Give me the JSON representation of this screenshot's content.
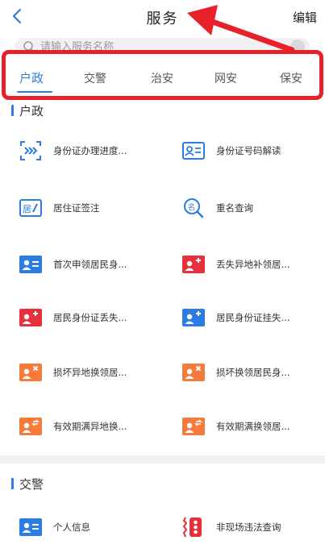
{
  "header": {
    "title": "服务",
    "edit_label": "编辑"
  },
  "search": {
    "placeholder": "请输入服务名称"
  },
  "tabs": [
    {
      "label": "户政",
      "active": true
    },
    {
      "label": "交警",
      "active": false
    },
    {
      "label": "治安",
      "active": false
    },
    {
      "label": "网安",
      "active": false
    },
    {
      "label": "保安",
      "active": false
    }
  ],
  "sections": [
    {
      "title": "户政",
      "items": [
        {
          "label": "身份证办理进度...",
          "icon": "scan-progress-icon",
          "color": "#2b7de3"
        },
        {
          "label": "身份证号码解读",
          "icon": "id-card-outline-icon",
          "color": "#2b7de3"
        },
        {
          "label": "居住证签注",
          "icon": "residence-permit-icon",
          "color": "#2b7de3"
        },
        {
          "label": "重名查询",
          "icon": "name-search-icon",
          "color": "#2b7de3"
        },
        {
          "label": "首次申领居民身...",
          "icon": "id-card-blue-icon",
          "color": "#2b7de3"
        },
        {
          "label": "丢失异地补领居...",
          "icon": "id-card-red-plus-icon",
          "color": "#e8303a"
        },
        {
          "label": "居民身份证丢失...",
          "icon": "id-card-red-plus-icon",
          "color": "#e8303a"
        },
        {
          "label": "居民身份证挂失...",
          "icon": "id-card-blue-plus-icon",
          "color": "#2b7de3"
        },
        {
          "label": "损坏异地换领居...",
          "icon": "id-card-orange-x-icon",
          "color": "#f47b3c"
        },
        {
          "label": "损坏换领居民身...",
          "icon": "id-card-orange-x-icon",
          "color": "#f47b3c"
        },
        {
          "label": "有效期满异地换...",
          "icon": "id-card-orange-swap-icon",
          "color": "#f47b3c"
        },
        {
          "label": "有效期满换领居...",
          "icon": "id-card-orange-swap-icon",
          "color": "#f47b3c"
        }
      ]
    },
    {
      "title": "交警",
      "items": [
        {
          "label": "个人信息",
          "icon": "id-card-blue-icon",
          "color": "#2b7de3"
        },
        {
          "label": "非现场违法查询",
          "icon": "violation-query-icon",
          "color": "#e8303a"
        }
      ]
    }
  ],
  "colors": {
    "accent": "#2b7de3",
    "annotation": "#e8202a",
    "orange": "#f47b3c",
    "red": "#e8303a"
  }
}
